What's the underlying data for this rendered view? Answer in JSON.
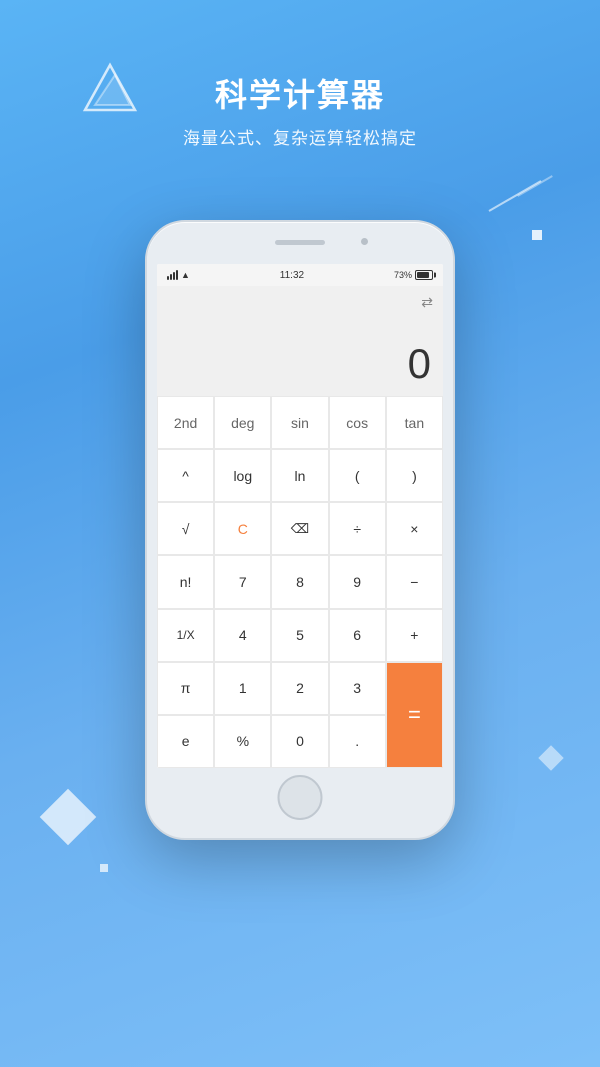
{
  "app": {
    "title": "科学计算器",
    "subtitle": "海量公式、复杂运算轻松搞定"
  },
  "phone": {
    "status": {
      "time": "11:32",
      "battery_percent": "73%"
    }
  },
  "calculator": {
    "display": "0",
    "keys": [
      [
        "2nd",
        "deg",
        "sin",
        "cos",
        "tan"
      ],
      [
        "^",
        "log",
        "ln",
        "(",
        ")"
      ],
      [
        "√",
        "C",
        "⌫",
        "÷",
        "×"
      ],
      [
        "n!",
        "7",
        "8",
        "9",
        "−"
      ],
      [
        "1/X",
        "4",
        "5",
        "6",
        "+"
      ],
      [
        "π",
        "1",
        "2",
        "3",
        "="
      ],
      [
        "e",
        "%",
        "0",
        ".",
        "="
      ]
    ],
    "buttons": {
      "row1": [
        "2nd",
        "deg",
        "sin",
        "cos",
        "tan"
      ],
      "row2": [
        "^",
        "log",
        "ln",
        "(",
        ")"
      ],
      "row3": [
        "√",
        "C",
        "⌫",
        "÷",
        "×"
      ],
      "row4": [
        "n!",
        "7",
        "8",
        "9",
        "−"
      ],
      "row5": [
        "1/X",
        "4",
        "5",
        "6",
        "+"
      ],
      "row6": [
        "π",
        "1",
        "2",
        "3",
        "="
      ],
      "row7": [
        "e",
        "%",
        "0",
        ".",
        ""
      ]
    }
  }
}
